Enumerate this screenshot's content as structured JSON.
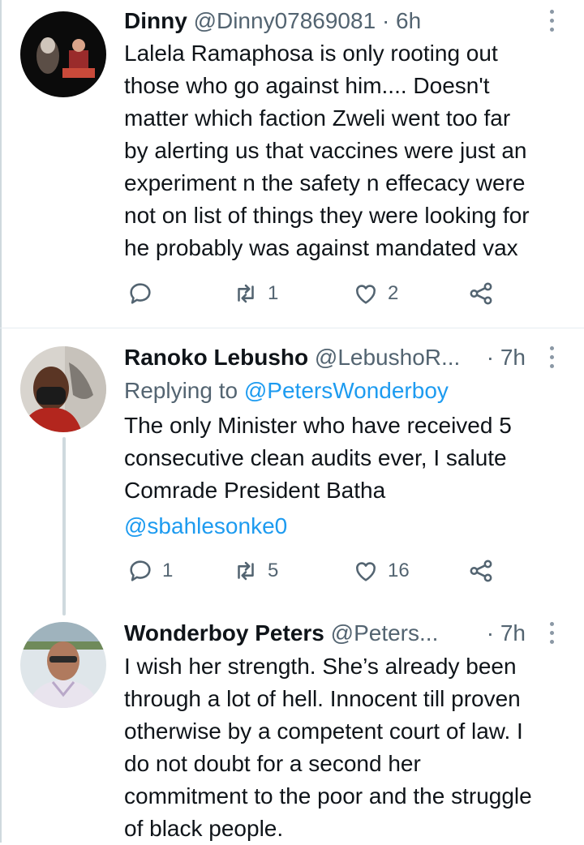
{
  "tweets": [
    {
      "name": "Dinny",
      "handle": "@Dinny07869081",
      "time": "· 6h",
      "text": "Lalela Ramaphosa is only rooting out\nthose who go against him.... Doesn't\nmatter which faction Zweli went too far\nby alerting us that vaccines were just an\nexperiment n the safety n effecacy were\nnot on list of things they were looking for\nhe probably was against mandated vax",
      "counts": {
        "replies": "",
        "retweets": "1",
        "likes": "2"
      }
    },
    {
      "name": "Ranoko Lebusho",
      "handle": "@LebushoR...",
      "time": "· 7h",
      "replying_prefix": "Replying to",
      "replying_to": "@PetersWonderboy",
      "text": "The only Minister who have received 5\nconsecutive clean audits ever, I salute\nComrade President Batha",
      "mention": "@sbahlesonke0",
      "counts": {
        "replies": "1",
        "retweets": "5",
        "likes": "16"
      }
    },
    {
      "name": "Wonderboy Peters",
      "handle": "@Peters...",
      "time": "· 7h",
      "text": "I wish her strength. She’s already been\nthrough a lot of hell. Innocent till proven\notherwise by a competent court of law. I\ndo not doubt for a second her\ncommitment to the poor and the struggle\nof black people."
    }
  ],
  "colors": {
    "accent": "#1d9bf0",
    "secondary": "#536471",
    "text": "#0f1419",
    "line": "#cfd9de"
  },
  "icons": [
    "reply-icon",
    "retweet-icon",
    "like-icon",
    "share-icon",
    "more-icon"
  ]
}
